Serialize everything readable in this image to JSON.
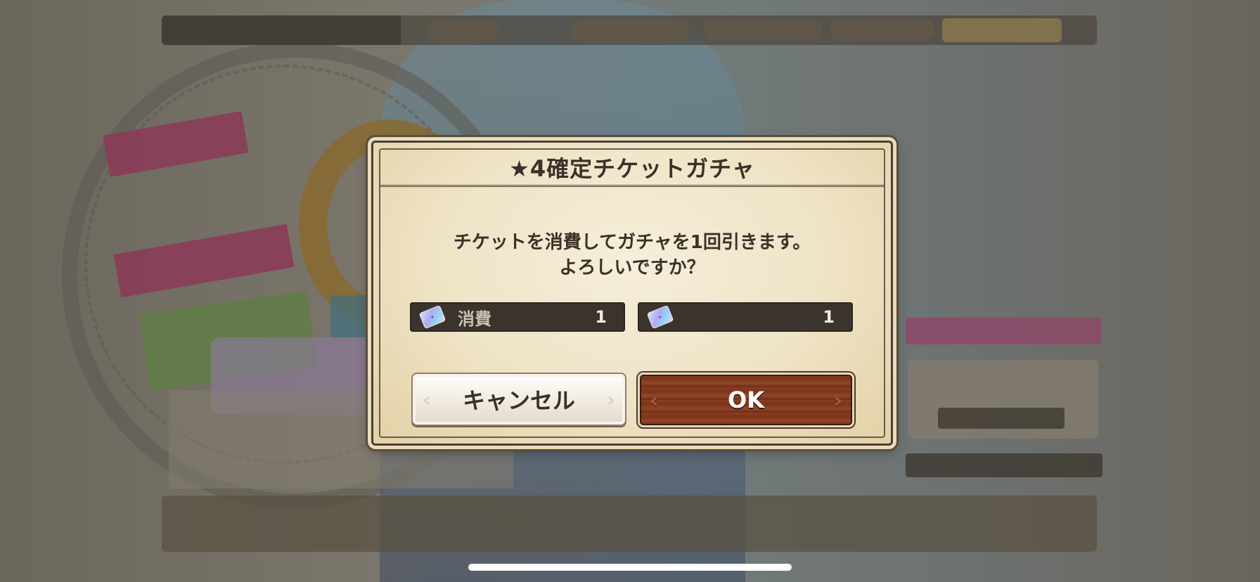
{
  "dialog": {
    "title": "★4確定チケットガチャ",
    "message_line1": "チケットを消費してガチャを1回引きます。",
    "message_line2": "よろしいですか？",
    "consume_ticket": {
      "label": "消費",
      "count": "1",
      "icon": "gacha-ticket-icon"
    },
    "owned_ticket": {
      "count": "1",
      "icon": "gacha-ticket-icon"
    },
    "cancel_label": "キャンセル",
    "ok_label": "OK"
  },
  "colors": {
    "dialog_bg": "#efe3c5",
    "ok_button": "#7a3418",
    "ticket_bar": "#3b342c"
  }
}
